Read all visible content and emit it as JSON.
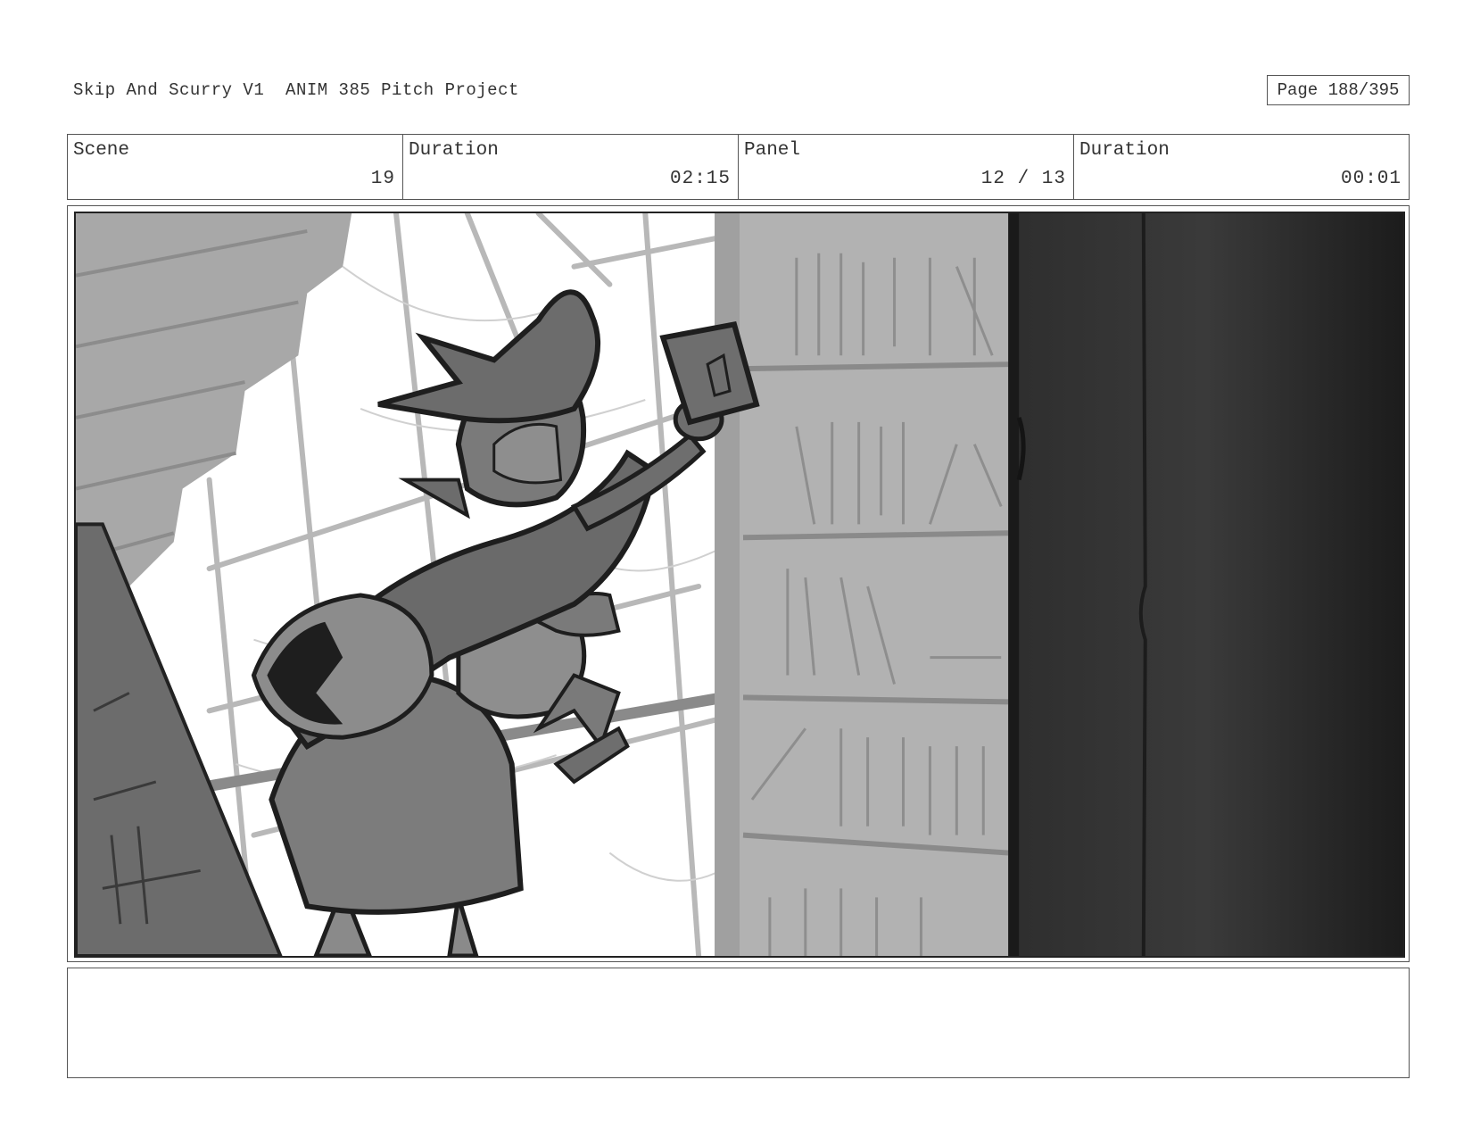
{
  "header": {
    "title": "Skip And Scurry V1  ANIM 385 Pitch Project",
    "page": "Page 188/395"
  },
  "info": {
    "scene_label": "Scene",
    "scene_value": "19",
    "duration_label": "Duration",
    "duration_value": "02:15",
    "panel_label": "Panel",
    "panel_value": "12 / 13",
    "panel_duration_label": "Duration",
    "panel_duration_value": "00:01"
  },
  "notes": {
    "text": ""
  }
}
